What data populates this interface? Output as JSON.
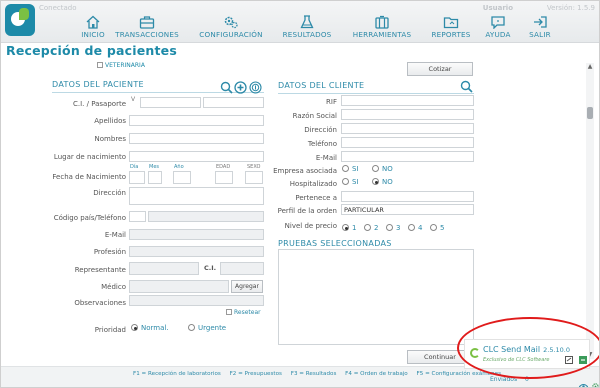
{
  "app": {
    "status": "Conectado",
    "user": "Usuario",
    "version": "Versión: 1.5.9"
  },
  "nav": [
    {
      "label": "INICIO",
      "icon": "home-icon"
    },
    {
      "label": "TRANSACCIONES",
      "icon": "briefcase-icon"
    },
    {
      "label": "CONFIGURACIÓN",
      "icon": "gears-icon"
    },
    {
      "label": "RESULTADOS",
      "icon": "flask-icon"
    },
    {
      "label": "HERRAMIENTAS",
      "icon": "toolbox-icon"
    },
    {
      "label": "REPORTES",
      "icon": "folder-icon"
    },
    {
      "label": "AYUDA",
      "icon": "help-icon"
    },
    {
      "label": "SALIR",
      "icon": "exit-icon"
    }
  ],
  "page": {
    "title": "Recepción de pacientes",
    "veterinaria": "VETERINARIA",
    "cotizar": "Cotizar",
    "continuar": "Continuar"
  },
  "patient": {
    "section_title": "DATOS DEL PACIENTE",
    "ci_label": "C.I. / Pasaporte",
    "ci_prefix": "V",
    "apellidos_label": "Apellidos",
    "nombres_label": "Nombres",
    "lugar_label": "Lugar de nacimiento",
    "fecha_label": "Fecha de Nacimiento",
    "dia_label": "Día",
    "mes_label": "Mes",
    "anio_label": "Año",
    "edad_label": "EDAD",
    "sexo_label": "SEXO",
    "direccion_label": "Dirección",
    "codigo_label": "Código país/Teléfono",
    "email_label": "E-Mail",
    "profesion_label": "Profesión",
    "representante_label": "Representante",
    "ci_short_label": "C.I.",
    "medico_label": "Médico",
    "agregar": "Agregar",
    "observaciones_label": "Observaciones",
    "resetear": "Resetear",
    "prioridad_label": "Prioridad",
    "prioridad_options": [
      "Normal.",
      "Urgente"
    ],
    "prioridad_selected": "Normal."
  },
  "client": {
    "section_title": "DATOS DEL CLIENTE",
    "rif_label": "RIF",
    "razon_label": "Razón Social",
    "direccion_label": "Dirección",
    "telefono_label": "Teléfono",
    "email_label": "E-Mail",
    "empresa_label": "Empresa asociada",
    "hospitalizado_label": "Hospitalizado",
    "si": "SI",
    "no": "NO",
    "empresa_selected": "NO",
    "hospitalizado_selected": "NO",
    "pertenece_label": "Pertenece a",
    "perfil_label": "Perfil de la orden",
    "perfil_value": "PARTICULAR",
    "nivel_label": "Nivel de precio",
    "nivel_options": [
      "1",
      "2",
      "3",
      "4",
      "5"
    ],
    "nivel_selected": "1",
    "pruebas_title": "PRUEBAS SELECCIONADAS"
  },
  "footer": {
    "shortcuts": [
      "F1 = Recepción de laboratorios",
      "F2 = Presupuestos",
      "F3 = Resultados",
      "F4 = Orden de trabajo",
      "F5 = Configuración exámenes"
    ],
    "enviados_label": "Enviados",
    "enviados_count": "0"
  },
  "sendmail": {
    "title": "CLC Send Mail",
    "version": "2.5.10.0",
    "subtitle": "Exclusivo de CLC Software"
  },
  "colors": {
    "accent": "#2d8aa8",
    "brand_green": "#7bc043",
    "highlight": "#e01b1b"
  }
}
